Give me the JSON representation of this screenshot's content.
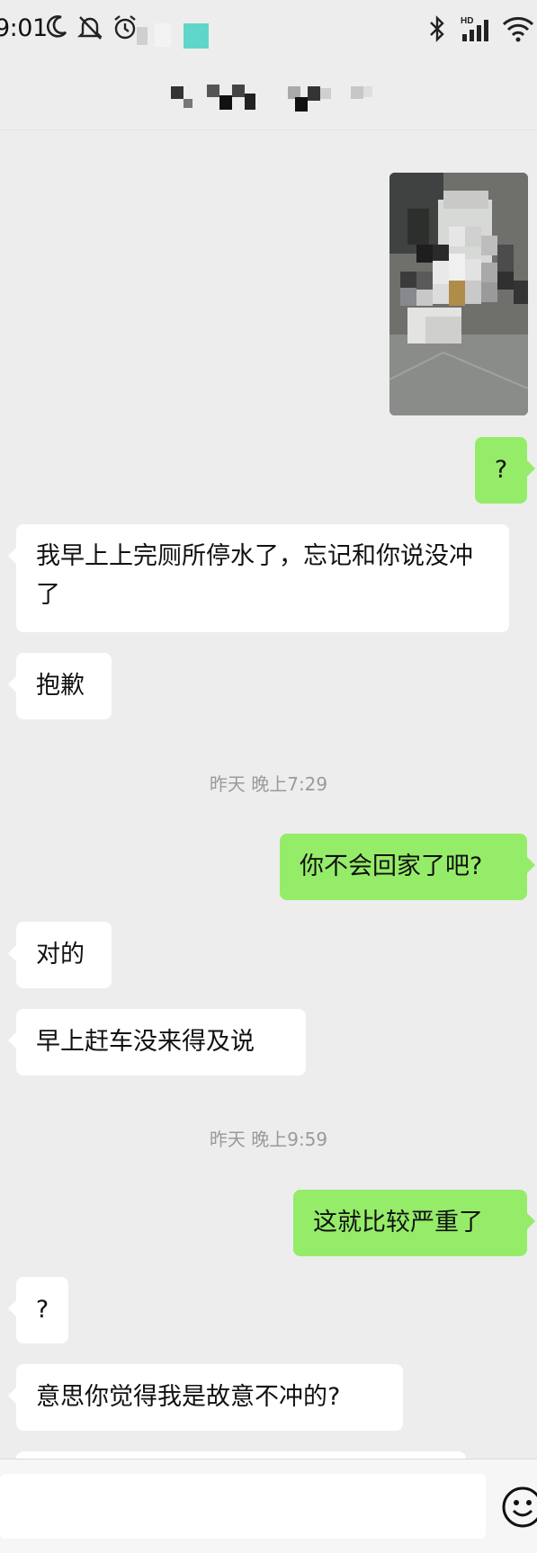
{
  "status_bar": {
    "time": "9:01",
    "icons": [
      "moon-icon",
      "bell-off-icon",
      "alarm-icon",
      "bluetooth-icon",
      "hd-signal-icon",
      "wifi-icon"
    ]
  },
  "chat": {
    "title_blurred": true,
    "messages": [
      {
        "side": "right",
        "type": "image",
        "description": "blurred photo"
      },
      {
        "side": "right",
        "text": "?"
      },
      {
        "side": "left",
        "text": "我早上上完厕所停水了，忘记和你说没冲了"
      },
      {
        "side": "left",
        "text": "抱歉"
      },
      {
        "timestamp": "昨天 晚上7:29"
      },
      {
        "side": "right",
        "text": "你不会回家了吧?"
      },
      {
        "side": "left",
        "text": "对的"
      },
      {
        "side": "left",
        "text": "早上赶车没来得及说"
      },
      {
        "timestamp": "昨天 晚上9:59"
      },
      {
        "side": "right",
        "text": "这就比较严重了"
      },
      {
        "side": "left",
        "text": "?"
      },
      {
        "side": "left",
        "text": "意思你觉得我是故意不冲的?"
      }
    ]
  },
  "input_bar": {
    "value": "",
    "icons": [
      "emoji-icon"
    ]
  },
  "colors": {
    "background": "#ededed",
    "bubble_self": "#95ec69",
    "bubble_other": "#ffffff",
    "timestamp": "#9a9a9a"
  }
}
